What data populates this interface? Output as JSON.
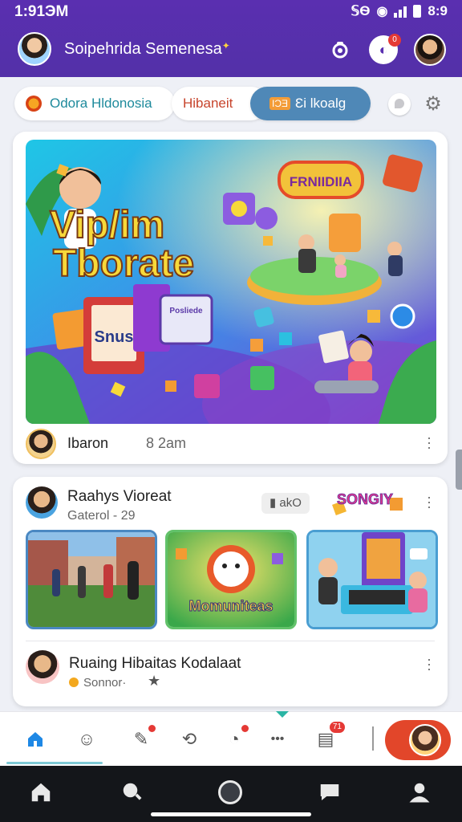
{
  "status_bar": {
    "time": "1:91ЭM",
    "indicators": "𝕊Ѳ",
    "battery_text": "8:9"
  },
  "header": {
    "title": "Soipehrida Semenesa",
    "message_badge": "0"
  },
  "chips": {
    "chip1": "Odora Hldonosia",
    "chip2": "Hibaneit",
    "chip3_tag": "IƆƎ",
    "chip3": "Ɛi lkoalg"
  },
  "post1": {
    "banner_line1": "Vip/im",
    "banner_line2": "Tborate",
    "banner_sign": "FRNIIDIIA",
    "screen_label1": "Snus",
    "screen_label2": "Posliede",
    "author": "Ibaron",
    "time": "8 2am"
  },
  "post2": {
    "title": "Raahys Vioreat",
    "subtitle": "Gaterol - 29",
    "pill": "akO",
    "promo": "SONGIY",
    "thumb2_label": "Momuniteas",
    "second_title": "Ruaing Hibaitas Kodalaat",
    "second_sub": "Sonnor·"
  },
  "tabbar": {
    "badge_counts": "71"
  },
  "colors": {
    "header": "#5a2fb0",
    "accent_home": "#1e88e5",
    "fab": "#e2462a",
    "chip3": "#4f88b7"
  }
}
